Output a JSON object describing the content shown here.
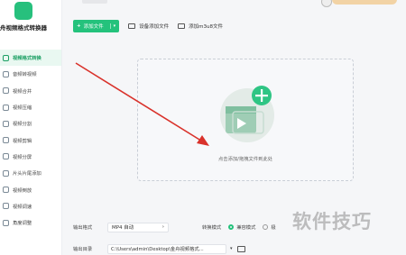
{
  "app": {
    "title": "舟视频格式转换器"
  },
  "sidebar": {
    "items": [
      {
        "label": "视频格式转换",
        "active": true
      },
      {
        "label": "音频转视频"
      },
      {
        "label": "视频合并"
      },
      {
        "label": "视频压缩"
      },
      {
        "label": "视频分割"
      },
      {
        "label": "视频剪辑"
      },
      {
        "label": "视频分屏"
      },
      {
        "label": "片头片尾添加"
      },
      {
        "label": "视频倒放"
      },
      {
        "label": "视频调速"
      },
      {
        "label": "角度调整"
      }
    ]
  },
  "toolbar": {
    "add_file": "添加文件",
    "device_add": "设备添加文件",
    "add_m3u8": "添加m3u8文件"
  },
  "dropzone": {
    "hint": "点击添加/拖拽文件到此处"
  },
  "bottom": {
    "output_format_label": "输出格式",
    "output_format_value": "MP4 自动",
    "convert_mode_label": "转换模式",
    "mode_compat": "兼容模式",
    "mode_fast": "极",
    "output_dir_label": "输出目录",
    "output_dir_value": "C:\\Users\\admin\\Desktop\\金舟视频格式..."
  },
  "watermark": "软件技巧",
  "colors": {
    "accent": "#24c27c",
    "arrow": "#d9322b"
  }
}
